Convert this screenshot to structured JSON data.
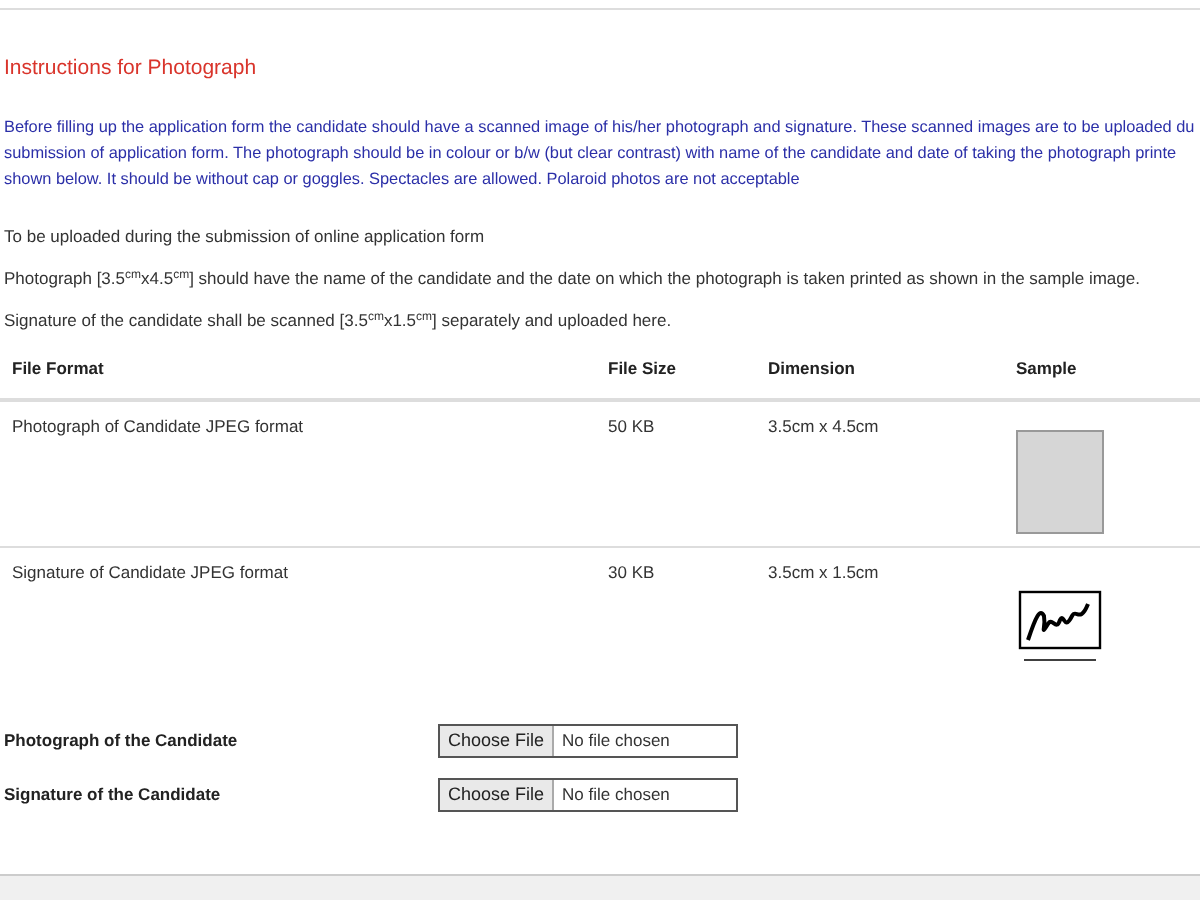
{
  "heading": "Instructions for Photograph",
  "instructions": "Before filling up the application form the candidate should have a scanned image of his/her photograph and signature. These scanned images are to be uploaded du submission of application form. The photograph should be in colour or b/w (but clear contrast) with name of the candidate and date of taking the photograph printe shown below. It should be without cap or goggles. Spectacles are allowed. Polaroid photos are not acceptable",
  "notes": [
    "To be uploaded during the submission of online application form",
    "Photograph [3.5$^{cm}$x4.5$^{cm}$] should have the name of the candidate and the date on which the photograph is taken printed as shown in the sample image.",
    "Signature of the candidate shall be scanned [3.5$^{cm}$x1.5$^{cm}$] separately and uploaded here."
  ],
  "table": {
    "columns": [
      "File Format",
      "File Size",
      "Dimension",
      "Sample"
    ],
    "rows": [
      {
        "file_format": "Photograph of Candidate JPEG format",
        "file_size": "50 KB",
        "dimension": "3.5cm x 4.5cm",
        "kind": "photo"
      },
      {
        "file_format": "Signature of Candidate JPEG format",
        "file_size": "30 KB",
        "dimension": "3.5cm x 1.5cm",
        "kind": "signature"
      }
    ]
  },
  "uploads": [
    {
      "label": "Photograph of the Candidate",
      "button": "Choose File",
      "status": "No file chosen"
    },
    {
      "label": "Signature of the Candidate",
      "button": "Choose File",
      "status": "No file chosen"
    }
  ]
}
